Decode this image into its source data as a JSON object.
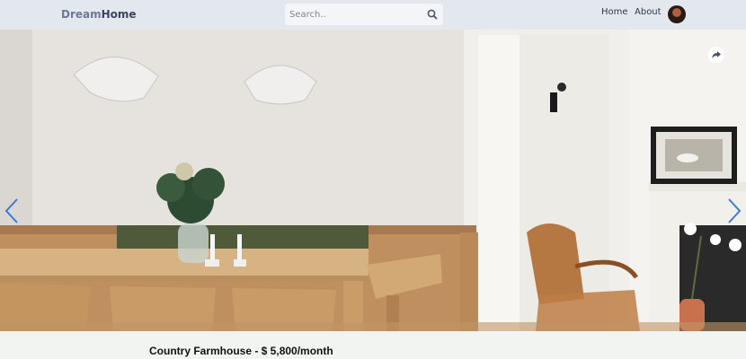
{
  "brand": {
    "part1": "Dream",
    "part2": "Home"
  },
  "search": {
    "placeholder": "Search.."
  },
  "nav": {
    "home": "Home",
    "about": "About"
  },
  "listing": {
    "caption": "Country Farmhouse - $ 5,800/month"
  },
  "icons": {
    "search": "search-icon",
    "share": "share-icon",
    "prev": "chevron-left-icon",
    "next": "chevron-right-icon"
  },
  "colors": {
    "navbar": "#e3e8ef",
    "arrow": "#3a7bd5",
    "footer": "#f1f4f1"
  }
}
